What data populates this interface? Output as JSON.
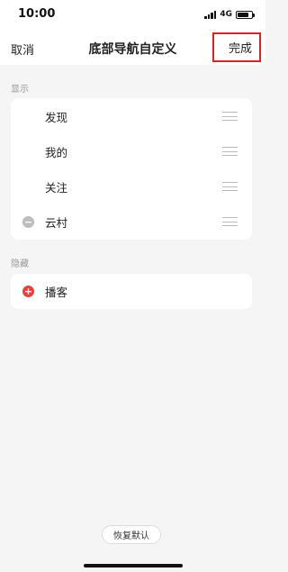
{
  "status_bar": {
    "time": "10:00",
    "network": "4G",
    "battery_level": 0.8
  },
  "nav": {
    "cancel_label": "取消",
    "title": "底部导航自定义",
    "done_label": "完成"
  },
  "sections": {
    "shown": {
      "label": "显示",
      "items": [
        {
          "label": "发现",
          "badge": ""
        },
        {
          "label": "我的",
          "badge": ""
        },
        {
          "label": "关注",
          "badge": ""
        },
        {
          "label": "云村",
          "badge": "remove"
        }
      ]
    },
    "hidden": {
      "label": "隐藏",
      "items": [
        {
          "label": "播客",
          "badge": "add"
        }
      ]
    }
  },
  "footer": {
    "restore_label": "恢复默认"
  },
  "colors": {
    "accent_red": "#e8423f",
    "highlight_border": "#e02020",
    "page_background": "#f5f5f5"
  }
}
